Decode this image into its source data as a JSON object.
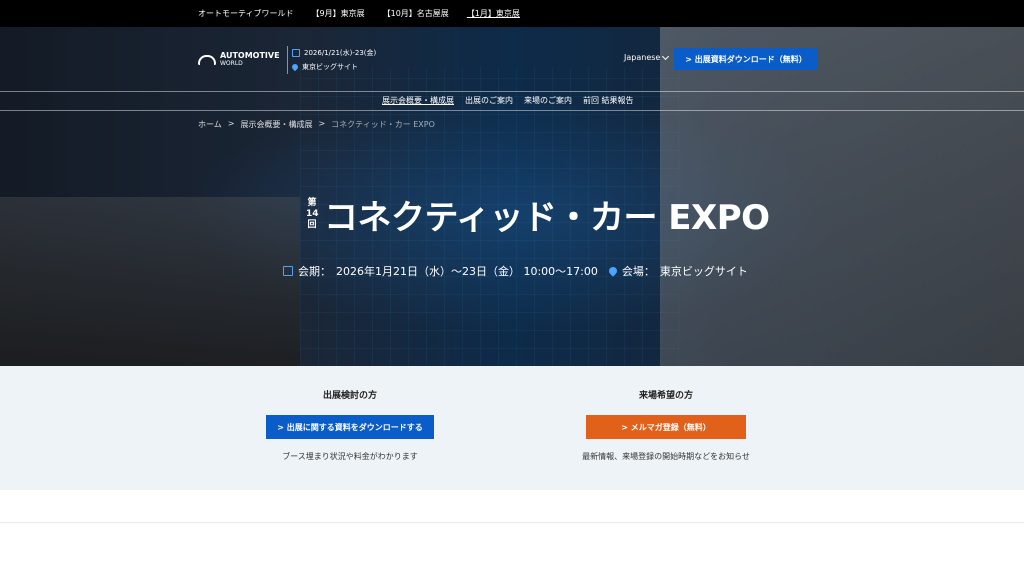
{
  "topbar": {
    "links": [
      "オートモーティブワールド",
      "【9月】東京展",
      "【10月】名古屋展",
      "【1月】東京展"
    ]
  },
  "header": {
    "logo_main": "AUTOMOTIVE",
    "logo_sub": "WORLD",
    "event_date": "2026/1/21(水)-23(金)",
    "event_venue": "東京ビッグサイト",
    "language": "Japanese",
    "download_button": "> 出展資料ダウンロード（無料）"
  },
  "nav": {
    "items": [
      "展示会概要・構成展",
      "出展のご案内",
      "来場のご案内",
      "前回 結果報告"
    ]
  },
  "breadcrumb": {
    "home": "ホーム",
    "sep": ">",
    "level1": "展示会概要・構成展",
    "current": "コネクティッド・カー EXPO"
  },
  "hero": {
    "edition_top": "第",
    "edition_num": "14",
    "edition_bottom": "回",
    "title": "コネクティッド・カー EXPO",
    "period_label": "会期：",
    "period": "2026年1月21日（水）～23日（金） 10:00～17:00",
    "venue_label": "会場：",
    "venue": "東京ビッグサイト"
  },
  "cta": {
    "exhibitor": {
      "heading": "出展検討の方",
      "button": "> 出展に関する資料をダウンロードする",
      "note": "ブース埋まり状況や料金がわかります"
    },
    "visitor": {
      "heading": "来場希望の方",
      "button": "> メルマガ登録（無料）",
      "note": "最新情報、来場登録の開始時期などをお知らせ"
    }
  },
  "colors": {
    "accent_blue": "#0a5cc8",
    "accent_orange": "#e1601a",
    "topbar_bg": "#000000",
    "cta_bg": "#eef3f7"
  }
}
